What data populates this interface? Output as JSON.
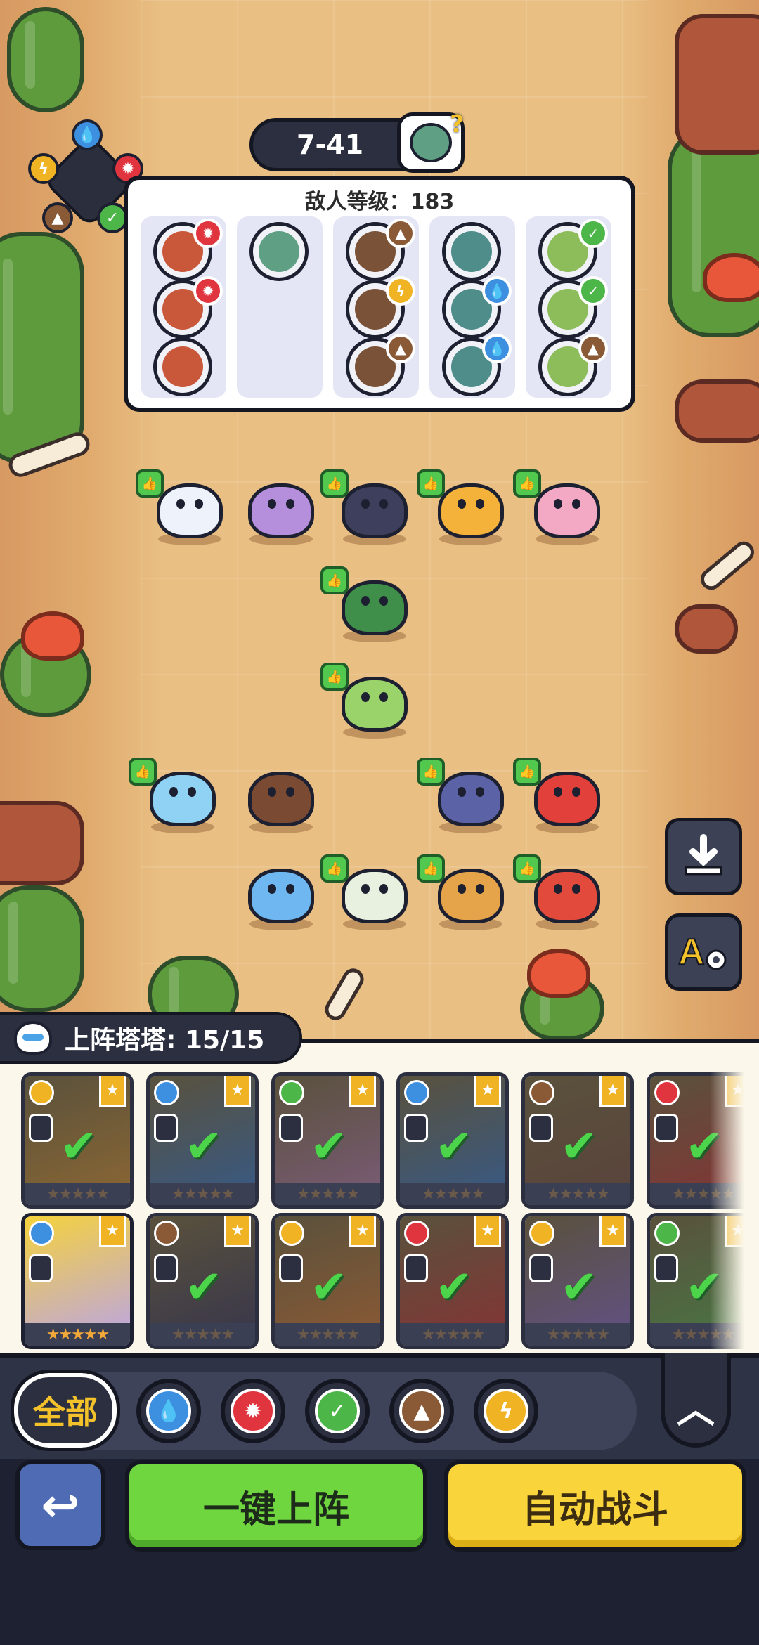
{
  "level": {
    "stage": "7-41"
  },
  "enemy_panel": {
    "title": "敌人等级：183",
    "columns": [
      {
        "units": [
          {
            "element": "fire"
          },
          {
            "element": "fire"
          },
          {
            "element": ""
          }
        ]
      },
      {
        "units": [
          {
            "element": ""
          }
        ]
      },
      {
        "units": [
          {
            "element": "earth"
          },
          {
            "element": "bolt"
          },
          {
            "element": "earth"
          }
        ]
      },
      {
        "units": [
          {
            "element": ""
          },
          {
            "element": "water"
          },
          {
            "element": "water"
          }
        ]
      },
      {
        "units": [
          {
            "element": "grass"
          },
          {
            "element": "grass"
          },
          {
            "element": "earth"
          }
        ]
      }
    ]
  },
  "element_cycle": [
    "water",
    "fire",
    "grass",
    "earth",
    "bolt"
  ],
  "field_units": [
    {
      "name": "white-bear",
      "color": "#eef3fb",
      "thumb": true
    },
    {
      "name": "purple-cat",
      "color": "#b68fdc",
      "thumb": false
    },
    {
      "name": "dark-dino",
      "color": "#3d3f5c",
      "thumb": true
    },
    {
      "name": "golden-lion",
      "color": "#f4b23a",
      "thumb": true
    },
    {
      "name": "pink-mantis",
      "color": "#f3a9c4",
      "thumb": true
    },
    {
      "name": "green-snail",
      "color": "#3f8f4a",
      "thumb": true
    },
    {
      "name": "flower-frog",
      "color": "#9bd36b",
      "thumb": true
    },
    {
      "name": "blue-seal",
      "color": "#8fd2f3",
      "thumb": true
    },
    {
      "name": "brown-weasel",
      "color": "#7a4a33",
      "thumb": false
    },
    {
      "name": "blue-boar",
      "color": "#5b62a6",
      "thumb": true
    },
    {
      "name": "red-salamander",
      "color": "#e2403a",
      "thumb": true
    },
    {
      "name": "blue-fish",
      "color": "#6fb7f0",
      "thumb": false
    },
    {
      "name": "radish-turtle",
      "color": "#e8f0df",
      "thumb": true
    },
    {
      "name": "horned-fox",
      "color": "#e5a34a",
      "thumb": true
    },
    {
      "name": "red-fox",
      "color": "#e24a3c",
      "thumb": true
    }
  ],
  "deploy_counter": {
    "label": "上阵塔塔: 15/15"
  },
  "cards": [
    {
      "element": "bolt",
      "color": "#e6a33a",
      "selected": false
    },
    {
      "element": "water",
      "color": "#4a8ad1",
      "selected": false
    },
    {
      "element": "grass",
      "color": "#c78db5",
      "selected": false
    },
    {
      "element": "water",
      "color": "#4a8ad1",
      "selected": false
    },
    {
      "element": "earth",
      "color": "#8b6148",
      "selected": false
    },
    {
      "element": "fire",
      "color": "#d9453d",
      "selected": false
    },
    {
      "element": "water",
      "color": "#b9a3ea",
      "selected": true
    },
    {
      "element": "earth",
      "color": "#4c4866",
      "selected": false
    },
    {
      "element": "bolt",
      "color": "#e58a3b",
      "selected": false
    },
    {
      "element": "fire",
      "color": "#d9453d",
      "selected": false
    },
    {
      "element": "bolt",
      "color": "#9a7ad1",
      "selected": false
    },
    {
      "element": "grass",
      "color": "#6bbf5a",
      "selected": false
    }
  ],
  "filter": {
    "all_label": "全部",
    "elements": [
      "water",
      "fire",
      "grass",
      "earth",
      "bolt"
    ]
  },
  "actions": {
    "back_symbol": "↩",
    "deploy_label": "一键上阵",
    "auto_label": "自动战斗"
  },
  "colors": {
    "fire": "#e0353f",
    "water": "#3d8fe0",
    "grass": "#4cb648",
    "earth": "#8a5a37",
    "bolt": "#f0b324"
  }
}
